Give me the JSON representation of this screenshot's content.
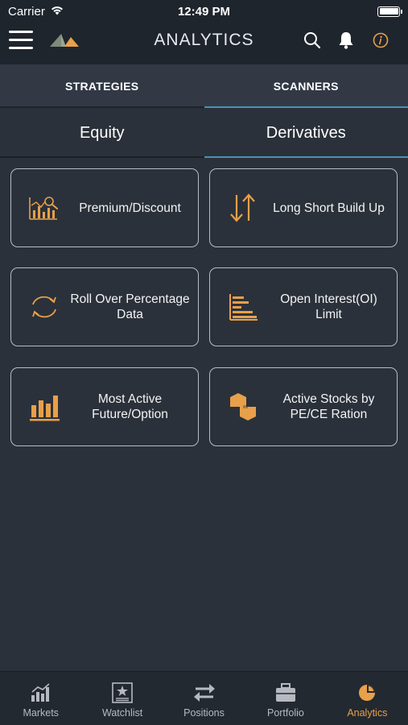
{
  "status_bar": {
    "carrier": "Carrier",
    "time": "12:49 PM"
  },
  "nav": {
    "title": "ANALYTICS",
    "icons": [
      "menu-icon",
      "logo",
      "search-icon",
      "bell-icon",
      "info-icon"
    ]
  },
  "top_tabs": [
    {
      "label": "STRATEGIES",
      "active": false
    },
    {
      "label": "SCANNERS",
      "active": true
    }
  ],
  "sub_tabs": [
    {
      "label": "Equity",
      "active": false
    },
    {
      "label": "Derivatives",
      "active": true
    }
  ],
  "cards": [
    {
      "label": "Premium/Discount",
      "icon": "chart-magnifier-icon"
    },
    {
      "label": "Long Short Build Up",
      "icon": "up-down-arrows-icon"
    },
    {
      "label": "Roll Over Percentage Data",
      "icon": "rollover-cycle-icon"
    },
    {
      "label": "Open Interest(OI) Limit",
      "icon": "horizontal-bars-icon"
    },
    {
      "label": "Most Active Future/Option",
      "icon": "bar-chart-icon"
    },
    {
      "label": "Active Stocks by PE/CE Ration",
      "icon": "swap-tags-icon"
    }
  ],
  "bottom_tabs": [
    {
      "label": "Markets",
      "icon": "markets-icon",
      "active": false
    },
    {
      "label": "Watchlist",
      "icon": "watchlist-icon",
      "active": false
    },
    {
      "label": "Positions",
      "icon": "positions-icon",
      "active": false
    },
    {
      "label": "Portfolio",
      "icon": "portfolio-icon",
      "active": false
    },
    {
      "label": "Analytics",
      "icon": "analytics-icon",
      "active": true
    }
  ],
  "colors": {
    "accent": "#e8a04a",
    "tab_indicator": "#4a8fb5",
    "background": "#2b313a",
    "header": "#1f252d"
  }
}
